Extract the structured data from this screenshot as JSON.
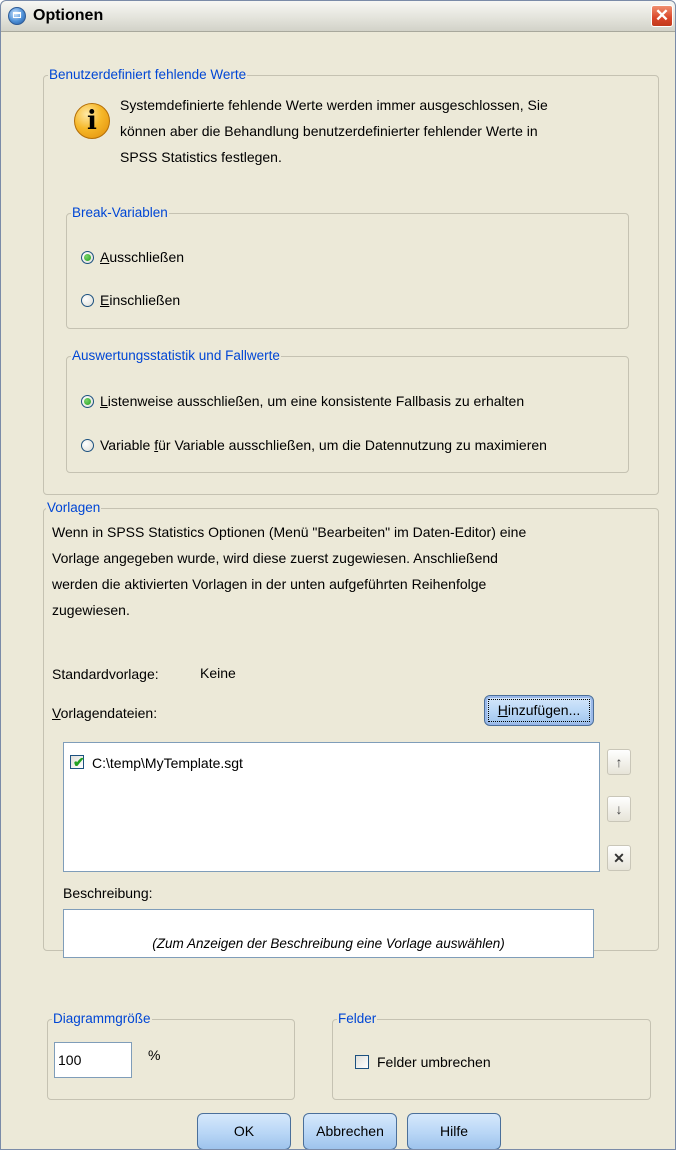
{
  "window": {
    "title": "Optionen",
    "close_glyph": "✕"
  },
  "missing": {
    "group_label": "Benutzerdefiniert fehlende Werte",
    "info_lines": [
      "Systemdefinierte fehlende Werte werden immer ausgeschlossen, Sie",
      "können aber die Behandlung benutzerdefinierter fehlender Werte in",
      "SPSS Statistics festlegen."
    ],
    "break_group": {
      "label": "Break-Variablen",
      "options": [
        {
          "mnemonic": "A",
          "rest": "usschließen",
          "checked": true
        },
        {
          "mnemonic": "E",
          "rest": "inschließen",
          "checked": false
        }
      ]
    },
    "stats_group": {
      "label": "Auswertungsstatistik und Fallwerte",
      "options": [
        {
          "before": "",
          "mnemonic": "L",
          "rest": "istenweise ausschließen, um eine konsistente Fallbasis zu erhalten",
          "checked": true
        },
        {
          "before": "Variable ",
          "mnemonic": "f",
          "rest": "ür Variable ausschließen, um die Datennutzung zu maximieren",
          "checked": false
        }
      ]
    }
  },
  "templates": {
    "group_label": "Vorlagen",
    "description_lines": [
      "Wenn in SPSS Statistics Optionen (Menü \"Bearbeiten\" im Daten-Editor) eine",
      "Vorlage angegeben wurde, wird diese zuerst zugewiesen. Anschließend",
      "werden die aktivierten Vorlagen in der unten aufgeführten Reihenfolge",
      "zugewiesen."
    ],
    "default_label": "Standardvorlage:",
    "default_value": "Keine",
    "files_label_mnemonic": "V",
    "files_label_rest": "orlagendateien:",
    "add_button_mnemonic": "H",
    "add_button_rest": "inzufügen...",
    "files": [
      {
        "path": "C:\\temp\\MyTemplate.sgt",
        "checked": true
      }
    ],
    "side_buttons": {
      "up": "↑",
      "down": "↓",
      "delete": "✕"
    },
    "desc_label": "Beschreibung:",
    "desc_placeholder": "(Zum Anzeigen der Beschreibung eine Vorlage auswählen)"
  },
  "chart_size": {
    "group_label": "Diagrammgröße",
    "value": "100",
    "unit": "%"
  },
  "panels": {
    "group_label": "Felder",
    "wrap_label": "Felder umbrechen",
    "wrap_checked": false
  },
  "footer": {
    "ok": "OK",
    "cancel": "Abbrechen",
    "help": "Hilfe"
  }
}
